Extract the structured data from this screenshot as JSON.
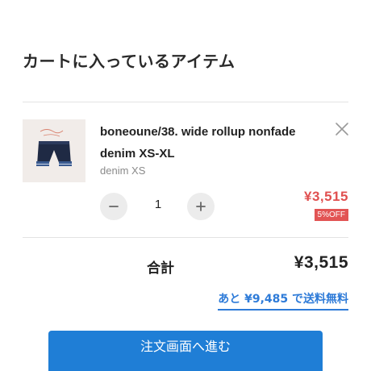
{
  "cart": {
    "title": "カートに入っているアイテム"
  },
  "item": {
    "name": "boneoune/38. wide rollup nonfade denim XS-XL",
    "variant": "denim XS",
    "quantity": "1",
    "price": "¥3,515",
    "discount_badge": "5%OFF"
  },
  "summary": {
    "total_label": "合計",
    "total_value": "¥3,515",
    "free_shipping_note": "あと ¥9,485 で送料無料"
  },
  "actions": {
    "checkout_label": "注文画面へ進む"
  },
  "colors": {
    "price": "#e04f4f",
    "discount_badge": "#e25454",
    "link": "#2e7bd8",
    "checkout_button": "#1f7ed6"
  },
  "icons": {
    "remove": "close-icon",
    "decrease": "minus-icon",
    "increase": "plus-icon"
  }
}
